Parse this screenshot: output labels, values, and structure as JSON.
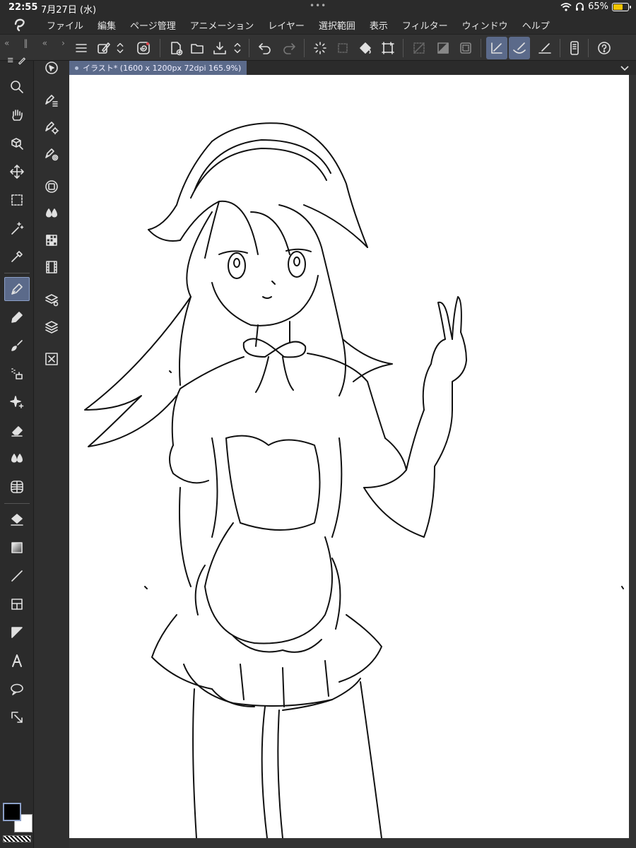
{
  "status": {
    "time": "22:55",
    "date": "7月27日 (水)",
    "dots": "•••",
    "battery_text": "65%",
    "battery_level": 0.65
  },
  "menu": [
    "ファイル",
    "編集",
    "ページ管理",
    "アニメーション",
    "レイヤー",
    "選択範囲",
    "表示",
    "フィルター",
    "ウィンドウ",
    "ヘルプ"
  ],
  "document_tab": {
    "title": "イラスト* (1600 x 1200px 72dpi 165.9%)"
  },
  "tools": [
    "zoom-tool",
    "hand-tool",
    "object-tool",
    "move-tool",
    "selection-tool",
    "auto-select-tool",
    "eyedropper-tool",
    "pen-tool",
    "pencil-tool",
    "brush-tool",
    "airbrush-tool",
    "decoration-tool",
    "eraser-tool",
    "blend-tool",
    "figure-ruler-tool",
    "fill-tool",
    "gradient-tool",
    "line-tool",
    "frame-tool",
    "ruler-tool",
    "text-tool",
    "balloon-tool",
    "correct-line-tool"
  ],
  "colors": {
    "main": "#000000",
    "sub": "#ffffff",
    "accent": "#5b6a8a",
    "battery": "#f2c500"
  }
}
